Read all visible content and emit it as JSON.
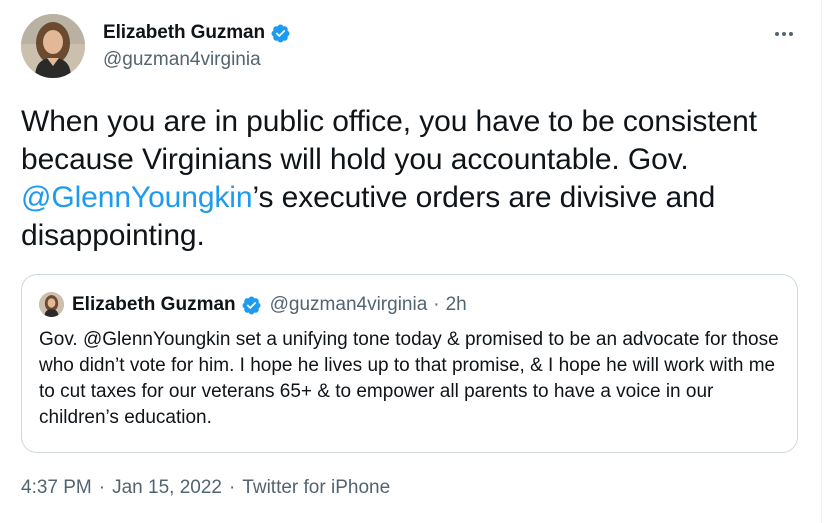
{
  "author": {
    "name": "Elizabeth Guzman",
    "handle": "@guzman4virginia"
  },
  "icons": {
    "verified": "verified-badge-icon",
    "more": "more-horizontal-icon",
    "verified_color": "#1d9bf0"
  },
  "tweet": {
    "text_1": "When you are in public office, you have to be consistent because Virginians will hold you accountable. Gov. ",
    "mention": "@GlennYoungkin",
    "text_2": "’s executive orders are divisive and disappointing."
  },
  "quote": {
    "name": "Elizabeth Guzman",
    "handle": "@guzman4virginia",
    "dot": "·",
    "time": "2h",
    "text": "Gov. @GlennYoungkin set a unifying tone today & promised to be an advocate for those who didn’t vote for him. I hope he lives up to that promise, & I hope he will work with me to cut taxes for our veterans 65+ & to empower all parents to have a voice in our children’s education."
  },
  "meta": {
    "time": "4:37 PM",
    "sep": "·",
    "date": "Jan 15, 2022",
    "source": "Twitter for iPhone"
  },
  "colors": {
    "link": "#1d9bf0",
    "secondary_text": "#536471",
    "primary_text": "#0f1419",
    "border": "#cfd9de"
  }
}
